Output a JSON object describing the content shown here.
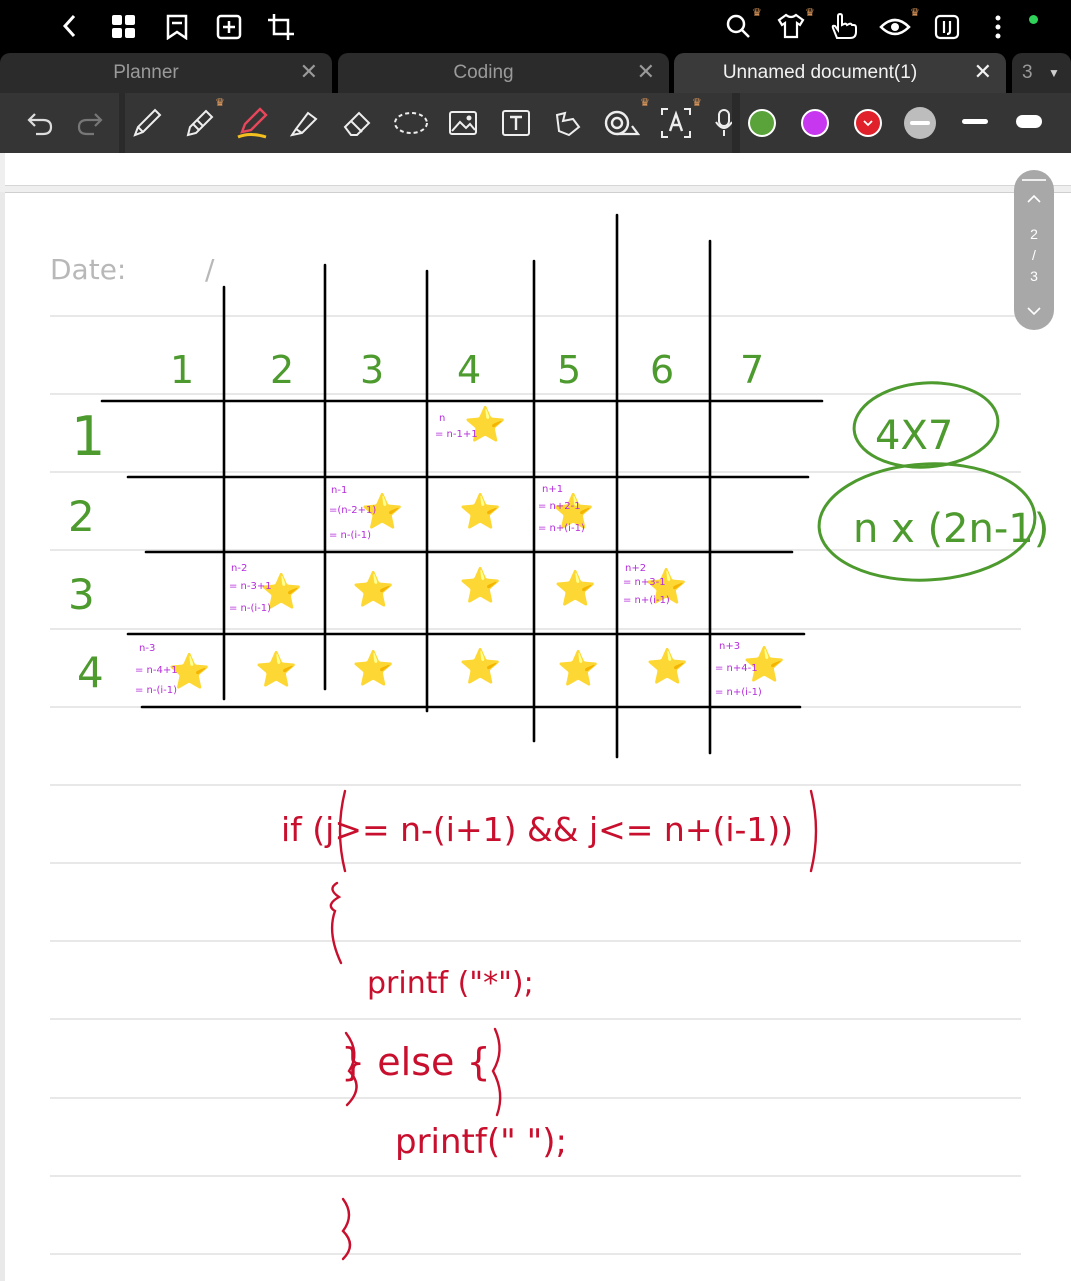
{
  "toolbar_top": {
    "icons": [
      "back-icon",
      "grid-icon",
      "bookmark-icon",
      "add-page-icon",
      "crop-icon",
      "search-icon",
      "tshirt-icon",
      "hand-gesture-icon",
      "eye-icon",
      "ij-icon",
      "more-icon"
    ]
  },
  "tabs": [
    {
      "label": "Planner",
      "close": "✕"
    },
    {
      "label": "Coding",
      "close": "✕"
    },
    {
      "label": "Unnamed document(1)",
      "close": "✕"
    },
    {
      "label": "3"
    }
  ],
  "pen_colors": [
    "#5aa23a",
    "#c837f0",
    "#e0202a",
    "#bdbdbd"
  ],
  "page": {
    "date_label": "Date:",
    "date_separator": "/",
    "scroll": {
      "current": "2",
      "sep": "/",
      "total": "3"
    }
  },
  "note": {
    "col_headers": [
      "1",
      "2",
      "3",
      "4",
      "5",
      "6",
      "7"
    ],
    "row_headers": [
      "1",
      "2",
      "3",
      "4"
    ],
    "size_label": "4X7",
    "size_formula": "n x (2n-1)",
    "cell_notes": {
      "r1c4": [
        "n",
        "= n-1+1"
      ],
      "r2c3": [
        "n-1",
        "=(n-2+1)",
        "= n-(i-1)"
      ],
      "r2c5": [
        "n+1",
        "= n+2-1",
        "= n+(i-1)"
      ],
      "r3c2": [
        "n-2",
        "= n-3+1",
        "= n-(i-1)"
      ],
      "r3c6": [
        "n+2",
        "= n+3-1",
        "= n+(i-1)"
      ],
      "r4c1": [
        "n-3",
        "= n-4+1",
        "= n-(i-1)"
      ],
      "r4c7": [
        "n+3",
        "= n+4-1",
        "= n+(i-1)"
      ]
    },
    "code": {
      "line1": "if (j>= n-(i+1) && j<= n+(i-1))",
      "line2": "{",
      "line3": "printf (\"*\");",
      "line4": "} else {",
      "line5": "printf(\" \");",
      "line6": "}"
    }
  }
}
